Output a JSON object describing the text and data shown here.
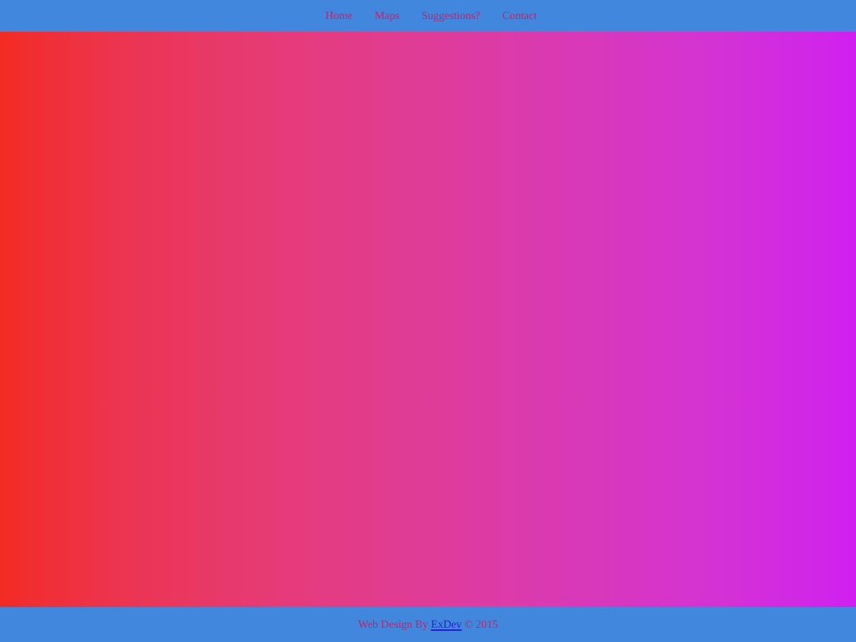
{
  "nav": {
    "links": [
      {
        "label": "Home"
      },
      {
        "label": "Maps"
      },
      {
        "label": "Suggestions?"
      },
      {
        "label": "Contact"
      }
    ]
  },
  "footer": {
    "text_before": "Web Design By ",
    "link": "ExDev",
    "text_after": " © 2015"
  }
}
